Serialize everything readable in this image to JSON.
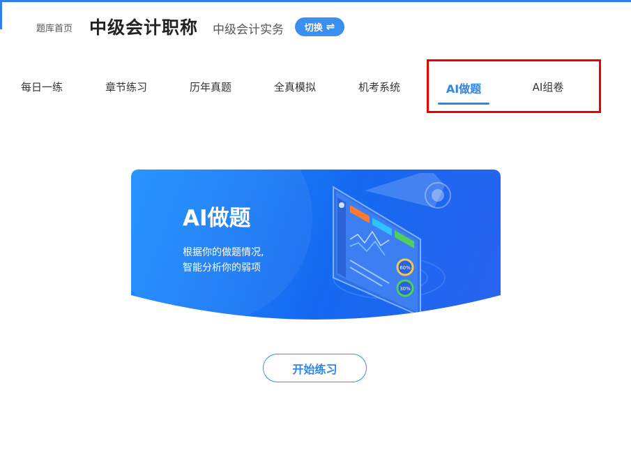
{
  "header": {
    "home_link": "题库首页",
    "title": "中级会计职称",
    "subject": "中级会计实务",
    "switch_label": "切换",
    "switch_icon": "swap-arrows-icon"
  },
  "tabs": [
    {
      "label": "每日一练",
      "active": false
    },
    {
      "label": "章节练习",
      "active": false
    },
    {
      "label": "历年真题",
      "active": false
    },
    {
      "label": "全真模拟",
      "active": false
    },
    {
      "label": "机考系统",
      "active": false
    },
    {
      "label": "AI做题",
      "active": true
    },
    {
      "label": "AI组卷",
      "active": false
    }
  ],
  "banner": {
    "title": "AI做题",
    "desc_line1": "根据你的做题情况,",
    "desc_line2": "智能分析你的弱项",
    "gauge1": "60%",
    "gauge2": "30%"
  },
  "start_button": "开始练习",
  "colors": {
    "accent": "#2e86ea",
    "highlight": "#ee0000",
    "banner_start": "#1c8fff",
    "banner_end": "#2a63ef"
  }
}
